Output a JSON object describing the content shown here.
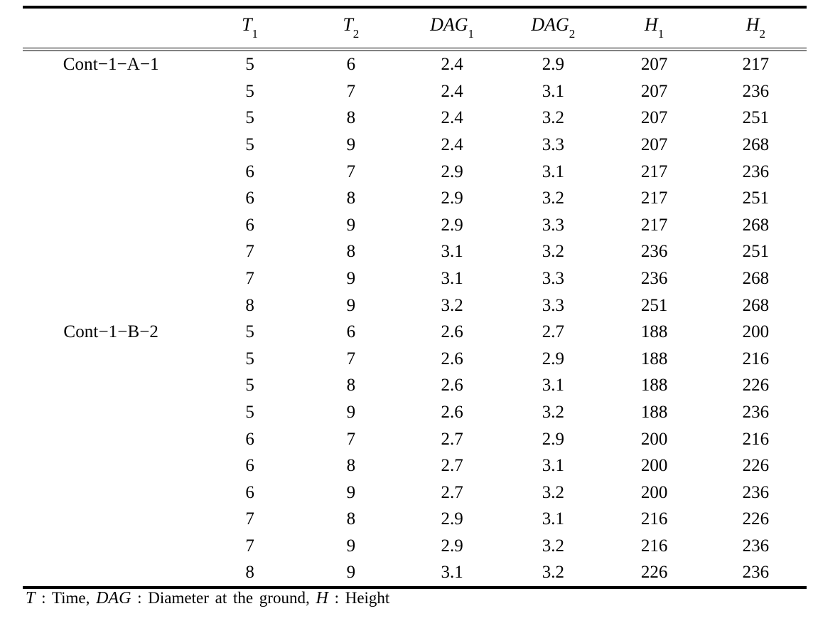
{
  "table": {
    "columns": [
      {
        "id": "group",
        "label": "",
        "sub": ""
      },
      {
        "id": "T1",
        "label": "T",
        "sub": "1"
      },
      {
        "id": "T2",
        "label": "T",
        "sub": "2"
      },
      {
        "id": "DAG1",
        "label": "DAG",
        "sub": "1"
      },
      {
        "id": "DAG2",
        "label": "DAG",
        "sub": "2"
      },
      {
        "id": "H1",
        "label": "H",
        "sub": "1"
      },
      {
        "id": "H2",
        "label": "H",
        "sub": "2"
      }
    ],
    "rows": [
      {
        "group": "Cont−1−A−1",
        "T1": "5",
        "T2": "6",
        "DAG1": "2.4",
        "DAG2": "2.9",
        "H1": "207",
        "H2": "217"
      },
      {
        "group": "",
        "T1": "5",
        "T2": "7",
        "DAG1": "2.4",
        "DAG2": "3.1",
        "H1": "207",
        "H2": "236"
      },
      {
        "group": "",
        "T1": "5",
        "T2": "8",
        "DAG1": "2.4",
        "DAG2": "3.2",
        "H1": "207",
        "H2": "251"
      },
      {
        "group": "",
        "T1": "5",
        "T2": "9",
        "DAG1": "2.4",
        "DAG2": "3.3",
        "H1": "207",
        "H2": "268"
      },
      {
        "group": "",
        "T1": "6",
        "T2": "7",
        "DAG1": "2.9",
        "DAG2": "3.1",
        "H1": "217",
        "H2": "236"
      },
      {
        "group": "",
        "T1": "6",
        "T2": "8",
        "DAG1": "2.9",
        "DAG2": "3.2",
        "H1": "217",
        "H2": "251"
      },
      {
        "group": "",
        "T1": "6",
        "T2": "9",
        "DAG1": "2.9",
        "DAG2": "3.3",
        "H1": "217",
        "H2": "268"
      },
      {
        "group": "",
        "T1": "7",
        "T2": "8",
        "DAG1": "3.1",
        "DAG2": "3.2",
        "H1": "236",
        "H2": "251"
      },
      {
        "group": "",
        "T1": "7",
        "T2": "9",
        "DAG1": "3.1",
        "DAG2": "3.3",
        "H1": "236",
        "H2": "268"
      },
      {
        "group": "",
        "T1": "8",
        "T2": "9",
        "DAG1": "3.2",
        "DAG2": "3.3",
        "H1": "251",
        "H2": "268"
      },
      {
        "group": "Cont−1−B−2",
        "T1": "5",
        "T2": "6",
        "DAG1": "2.6",
        "DAG2": "2.7",
        "H1": "188",
        "H2": "200"
      },
      {
        "group": "",
        "T1": "5",
        "T2": "7",
        "DAG1": "2.6",
        "DAG2": "2.9",
        "H1": "188",
        "H2": "216"
      },
      {
        "group": "",
        "T1": "5",
        "T2": "8",
        "DAG1": "2.6",
        "DAG2": "3.1",
        "H1": "188",
        "H2": "226"
      },
      {
        "group": "",
        "T1": "5",
        "T2": "9",
        "DAG1": "2.6",
        "DAG2": "3.2",
        "H1": "188",
        "H2": "236"
      },
      {
        "group": "",
        "T1": "6",
        "T2": "7",
        "DAG1": "2.7",
        "DAG2": "2.9",
        "H1": "200",
        "H2": "216"
      },
      {
        "group": "",
        "T1": "6",
        "T2": "8",
        "DAG1": "2.7",
        "DAG2": "3.1",
        "H1": "200",
        "H2": "226"
      },
      {
        "group": "",
        "T1": "6",
        "T2": "9",
        "DAG1": "2.7",
        "DAG2": "3.2",
        "H1": "200",
        "H2": "236"
      },
      {
        "group": "",
        "T1": "7",
        "T2": "8",
        "DAG1": "2.9",
        "DAG2": "3.1",
        "H1": "216",
        "H2": "226"
      },
      {
        "group": "",
        "T1": "7",
        "T2": "9",
        "DAG1": "2.9",
        "DAG2": "3.2",
        "H1": "216",
        "H2": "236"
      },
      {
        "group": "",
        "T1": "8",
        "T2": "9",
        "DAG1": "3.1",
        "DAG2": "3.2",
        "H1": "226",
        "H2": "236"
      }
    ]
  },
  "footnote": {
    "sym1": "T",
    "text1": ": Time,",
    "sym2": "DAG",
    "text2": ": Diameter at the ground,",
    "sym3": "H",
    "text3": ": Height"
  }
}
